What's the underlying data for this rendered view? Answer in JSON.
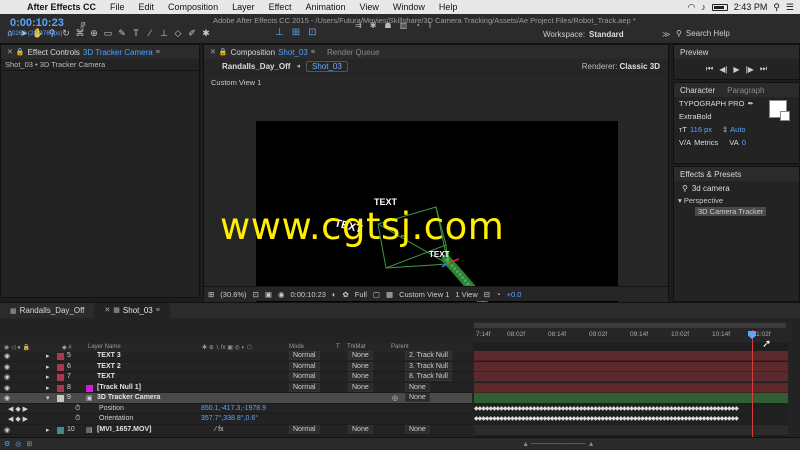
{
  "menubar": {
    "app_name": "After Effects CC",
    "items": [
      "File",
      "Edit",
      "Composition",
      "Layer",
      "Effect",
      "Animation",
      "View",
      "Window",
      "Help"
    ],
    "time": "2:43 PM"
  },
  "window": {
    "title": "Adobe After Effects CC 2015 - /Users/Futura/Movies/Skillshare/3D Camera Tracking/Assets/Ae Project Files/Robot_Track.aep *"
  },
  "toolbar": {
    "workspace_label": "Workspace:",
    "workspace_value": "Standard",
    "search_help": "Search Help"
  },
  "effect_controls": {
    "tab_label": "Effect Controls",
    "tab_target": "3D Tracker Camera",
    "subtitle": "Shot_03 • 3D Tracker Camera"
  },
  "composition": {
    "tab_label": "Composition",
    "tab_target": "Shot_03",
    "render_queue": "Render Queue",
    "subtab_1": "Randalls_Day_Off",
    "subtab_2": "Shot_03",
    "renderer_label": "Renderer:",
    "renderer_value": "Classic 3D",
    "view_label": "Custom View 1",
    "scene_texts": [
      "TEXT",
      "TEXT",
      "TEXT",
      "text"
    ],
    "footer": {
      "zoom": "(30.6%)",
      "timecode": "0:00:10:23",
      "resolution": "Full",
      "view": "Custom View 1",
      "views": "1 View",
      "offset": "+0.0"
    }
  },
  "preview": {
    "tab_label": "Preview"
  },
  "character": {
    "tab_label": "Character",
    "tab_para": "Paragraph",
    "font": "TYPOGRAPH PRO",
    "style": "ExtraBold",
    "size": "116 px",
    "leading": "Auto",
    "kerning": "Metrics",
    "tracking": "0"
  },
  "effects_presets": {
    "tab_label": "Effects & Presets",
    "search_value": "3d camera",
    "category": "Perspective",
    "item": "3D Camera Tracker"
  },
  "timeline": {
    "tab_1": "Randalls_Day_Off",
    "tab_2": "Shot_03",
    "timecode": "0:00:10:23",
    "fps": "00263 (23.976 fps)",
    "ruler_ticks": [
      "7:14f",
      "08:02f",
      "08:14f",
      "09:02f",
      "09:14f",
      "10:02f",
      "10:14f",
      "11:02f"
    ],
    "col_headers": {
      "layer_name": "Layer Name",
      "mode": "Mode",
      "t": "T",
      "trkmat": "TrkMat",
      "parent": "Parent"
    },
    "layers": [
      {
        "num": "5",
        "name": "TEXT 3",
        "mode": "Normal",
        "trkmat": "None",
        "parent": "2. Track Null"
      },
      {
        "num": "6",
        "name": "TEXT 2",
        "mode": "Normal",
        "trkmat": "None",
        "parent": "3. Track Null"
      },
      {
        "num": "7",
        "name": "TEXT",
        "mode": "Normal",
        "trkmat": "None",
        "parent": "8. Track Null"
      },
      {
        "num": "8",
        "name": "[Track Null 1]",
        "mode": "Normal",
        "trkmat": "None",
        "parent": "None"
      },
      {
        "num": "9",
        "name": "3D Tracker Camera",
        "mode": "",
        "trkmat": "",
        "parent": "None"
      },
      {
        "num": "10",
        "name": "[MVI_1657.MOV]",
        "mode": "Normal",
        "trkmat": "None",
        "parent": "None"
      }
    ],
    "props": [
      {
        "name": "Position",
        "value": "850.1,-417.3,-1978.9"
      },
      {
        "name": "Orientation",
        "value": "357.7°,338.8°,0.6°"
      }
    ]
  },
  "watermark": "www.cgtsj.com",
  "colors": {
    "accent": "#5aa5ff",
    "watermark": "#ffef00",
    "track_red": "#5c2a2c",
    "track_green": "#2f5f33"
  }
}
